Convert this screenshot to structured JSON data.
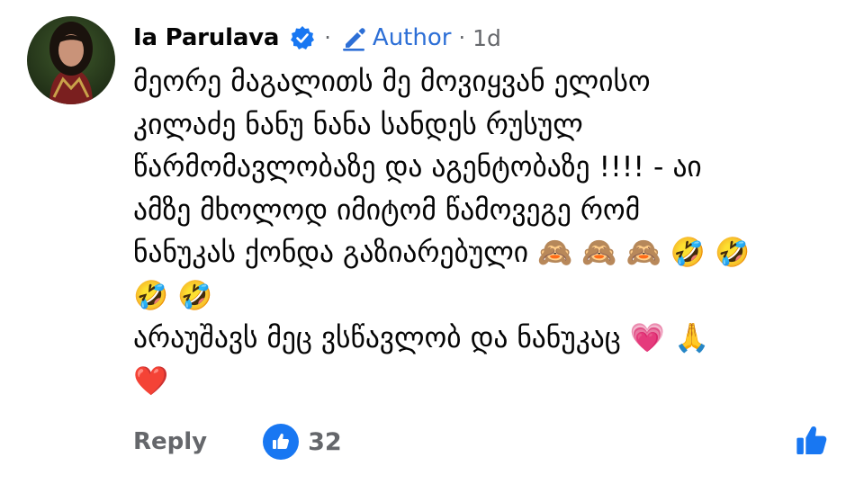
{
  "comment": {
    "author_name": "Ia Parulava",
    "separator": "·",
    "badge_label": "Author",
    "time": "1d",
    "lines": [
      "მეორე მაგალითს მე მოვიყვან ელისო",
      "კილაძე ნანუ ნანა სანდეს რუსულ",
      "წარმომავლობაზე და აგენტობაზე !!!! - აი",
      "ამზე მხოლოდ იმიტომ წამოვეგე რომ",
      "ნანუკას ქონდა გაზიარებული 🙈 🙈 🙈 🤣 🤣",
      "🤣 🤣",
      "არაუშავს მეც ვსწავლობ და ნანუკაც 💗 🙏",
      "❤️"
    ],
    "actions": {
      "reply_label": "Reply",
      "like_count": "32"
    },
    "icons": {
      "verified": "verified-badge-icon",
      "author_badge": "pencil-icon",
      "reaction": "thumbs-up-icon",
      "like_action": "thumbs-up-icon"
    },
    "colors": {
      "accent": "#1877f2",
      "badge_text": "#2d6fd6",
      "secondary_text": "#65676b",
      "primary_text": "#050505"
    }
  }
}
